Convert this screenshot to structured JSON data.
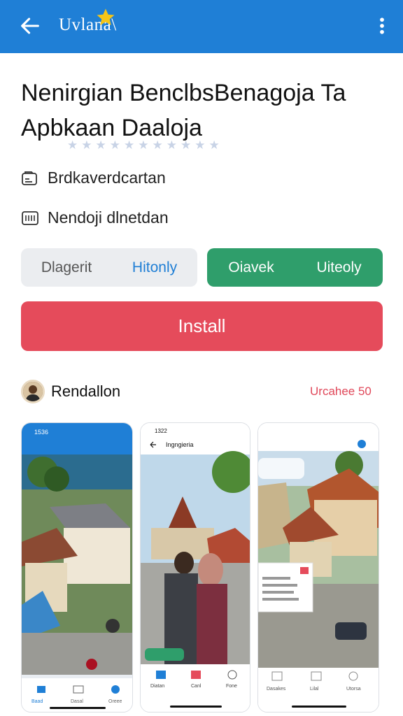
{
  "appbar": {
    "title": "Uvlana\\",
    "back_icon": "arrow-left-icon",
    "star_icon": "star-icon",
    "more_icon": "more-vertical-icon",
    "color": "#1f7fd6"
  },
  "app": {
    "headline": "Nenirgian BenclbsBenagoja Ta Apbkaan Daaloja",
    "rating_stars": 11
  },
  "info": [
    {
      "icon": "developer-card-icon",
      "label": "Brdkaverdcartan"
    },
    {
      "icon": "calendar-grid-icon",
      "label": "Nendoji dlnetdan"
    }
  ],
  "buttons": {
    "grey_left": "Dlagerit",
    "grey_right": "Hitonly",
    "green_left": "Oiavek",
    "green_right": "Uiteoly",
    "install": "Install"
  },
  "developer": {
    "name": "Rendallon",
    "link": "Urcahee 50"
  },
  "screenshots": {
    "first": {
      "time": "1536",
      "nav": [
        "Baad",
        "Dasal",
        "Oreee"
      ]
    },
    "second": {
      "time": "1322",
      "title": "Ingngieria",
      "nav": [
        "Diatan",
        "Canl",
        "Fone"
      ]
    },
    "third": {
      "nav": [
        "Dasakes",
        "Lilal",
        "Utorsa"
      ]
    }
  },
  "colors": {
    "install": "#e54b5b",
    "green": "#2f9e6b",
    "accent": "#1e7ed5"
  }
}
